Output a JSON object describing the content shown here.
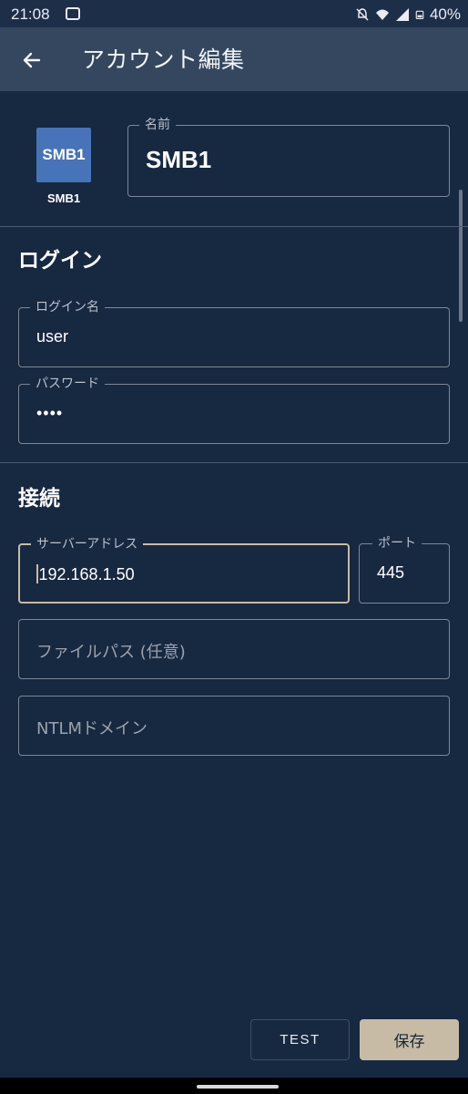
{
  "status_bar": {
    "time": "21:08",
    "battery": "40%",
    "icons": [
      "message-icon",
      "mute-icon",
      "wifi-icon",
      "signal-icon",
      "battery-icon"
    ]
  },
  "app_bar": {
    "title": "アカウント編集",
    "back_icon": "arrow-left-icon"
  },
  "account": {
    "icon_label": "SMB1",
    "caption": "SMB1",
    "name_label": "名前",
    "name_value": "SMB1"
  },
  "login": {
    "title": "ログイン",
    "username_label": "ログイン名",
    "username_value": "user",
    "password_label": "パスワード",
    "password_value": "••••"
  },
  "connection": {
    "title": "接続",
    "server_label": "サーバーアドレス",
    "server_value": "192.168.1.50",
    "port_label": "ポート",
    "port_value": "445",
    "filepath_placeholder": "ファイルパス (任意)",
    "domain_placeholder": "NTLMドメイン"
  },
  "actions": {
    "test_label": "TEST",
    "save_label": "保存"
  },
  "colors": {
    "background": "#172841",
    "app_bar": "#34475f",
    "accent": "#c8bba6",
    "account_icon": "#4773b9"
  }
}
